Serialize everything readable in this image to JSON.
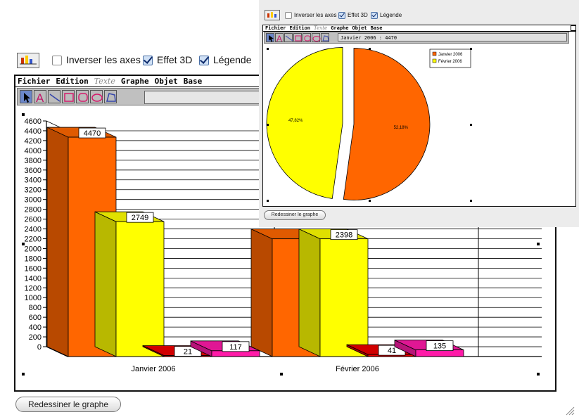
{
  "main": {
    "controls": {
      "invert_axes": {
        "label": "Inverser les axes",
        "checked": false
      },
      "effect_3d": {
        "label": "Effet 3D",
        "checked": true
      },
      "legend": {
        "label": "Légende",
        "checked": true
      }
    },
    "menu": [
      "Fichier",
      "Edition",
      "Texte",
      "Graphe",
      "Objet",
      "Base"
    ],
    "redraw_button": "Redessiner le graphe"
  },
  "popup": {
    "controls": {
      "invert_axes": {
        "label": "Inverser les axes",
        "checked": false
      },
      "effect_3d": {
        "label": "Effet 3D",
        "checked": true
      },
      "legend": {
        "label": "Légende",
        "checked": true
      }
    },
    "menu": [
      "Fichier",
      "Edition",
      "Texte",
      "Graphe",
      "Objet",
      "Base"
    ],
    "info_field": "Janvier 2006 : 4470",
    "redraw_button": "Redessiner le graphe"
  },
  "chart_data": [
    {
      "type": "bar",
      "categories": [
        "Janvier 2006",
        "Février 2006"
      ],
      "series": [
        {
          "values": [
            4470,
            2398
          ],
          "color": "#ff6600"
        },
        {
          "values": [
            2749,
            2398
          ],
          "color": "#ffff00"
        },
        {
          "values": [
            21,
            41
          ],
          "color": "#ee0000"
        },
        {
          "values": [
            117,
            135
          ],
          "color": "#ff1aa8"
        }
      ],
      "data_labels": [
        [
          "4470",
          "2749",
          "21",
          "117"
        ],
        [
          "",
          "2398",
          "41",
          "135"
        ]
      ],
      "ylim": [
        0,
        4600
      ],
      "yticks": [
        0,
        200,
        400,
        600,
        800,
        1000,
        1200,
        1400,
        1600,
        1800,
        2000,
        2200,
        2400,
        2600,
        2800,
        3000,
        3200,
        3400,
        3600,
        3800,
        4000,
        4200,
        4400,
        4600
      ],
      "grid": true
    },
    {
      "type": "pie",
      "slices": [
        {
          "label": "Janvier 2006",
          "value": 52.18,
          "text": "52,18%",
          "color": "#ff6600"
        },
        {
          "label": "Février 2006",
          "value": 47.82,
          "text": "47,82%",
          "color": "#ffff00"
        }
      ],
      "legend": [
        "Janvier 2006",
        "Février 2006"
      ],
      "legend_position": "top-right"
    }
  ]
}
